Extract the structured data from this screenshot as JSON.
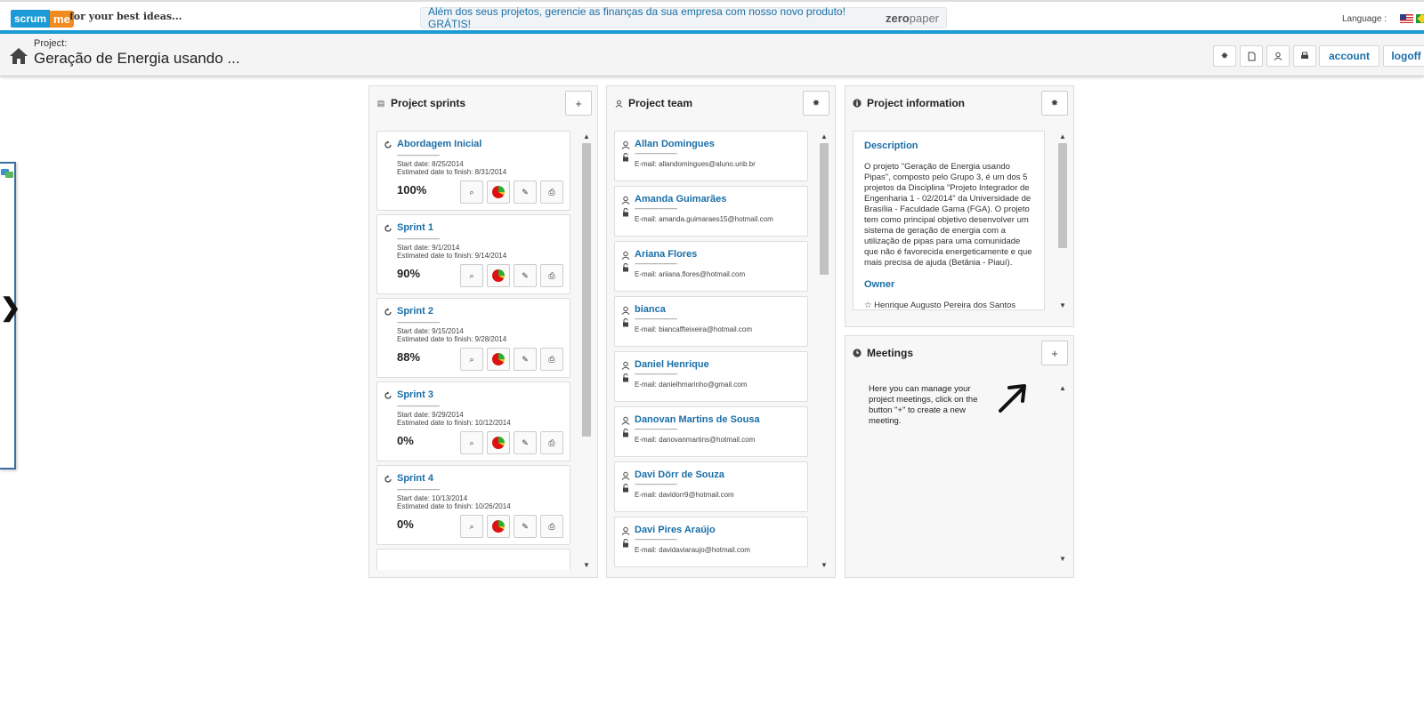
{
  "header": {
    "logo_left": "scrum",
    "logo_right": "me",
    "tagline": "for your best ideas...",
    "promo_text": "Além dos seus projetos, gerencie as finanças da sua empresa com nosso novo produto!  GRÁTIS!",
    "promo_logo_a": "zero",
    "promo_logo_b": "paper",
    "language_label": "Language :"
  },
  "project": {
    "label": "Project:",
    "title": "Geração de Energia usando ...",
    "account_label": "account",
    "logoff_label": "logoff"
  },
  "sprints_panel": {
    "title": "Project sprints",
    "add_label": "+",
    "items": [
      {
        "name": "Abordagem Inicial",
        "dash": "----------------------",
        "start": "Start date: 8/25/2014",
        "finish": "Estimated date to finish: 8/31/2014",
        "percent": "100%"
      },
      {
        "name": "Sprint 1",
        "dash": "----------------------",
        "start": "Start date: 9/1/2014",
        "finish": "Estimated date to finish: 9/14/2014",
        "percent": "90%"
      },
      {
        "name": "Sprint 2",
        "dash": "----------------------",
        "start": "Start date: 9/15/2014",
        "finish": "Estimated date to finish: 9/28/2014",
        "percent": "88%"
      },
      {
        "name": "Sprint 3",
        "dash": "----------------------",
        "start": "Start date: 9/29/2014",
        "finish": "Estimated date to finish: 10/12/2014",
        "percent": "0%"
      },
      {
        "name": "Sprint 4",
        "dash": "----------------------",
        "start": "Start date: 10/13/2014",
        "finish": "Estimated date to finish: 10/26/2014",
        "percent": "0%"
      }
    ]
  },
  "team_panel": {
    "title": "Project team",
    "members": [
      {
        "name": "Allan Domingues",
        "dash": "----------------------",
        "email": "E-mail: allandomingues@aluno.unb.br"
      },
      {
        "name": "Amanda Guimarães",
        "dash": "----------------------",
        "email": "E-mail: amanda.guimaraes15@hotmail.com"
      },
      {
        "name": "Ariana Flores",
        "dash": "----------------------",
        "email": "E-mail: ariiana.flores@hotmail.com"
      },
      {
        "name": "bianca",
        "dash": "----------------------",
        "email": "E-mail: biancaffteixeira@hotmail.com"
      },
      {
        "name": "Daniel Henrique",
        "dash": "----------------------",
        "email": "E-mail: danielhmarinho@gmail.com"
      },
      {
        "name": "Danovan Martins de Sousa",
        "dash": "----------------------",
        "email": "E-mail: danovanmartins@hotmail.com"
      },
      {
        "name": "Davi Dörr de Souza",
        "dash": "----------------------",
        "email": "E-mail: davidorr9@hotmail.com"
      },
      {
        "name": "Davi Pires Araújo",
        "dash": "----------------------",
        "email": "E-mail: davidaviaraujo@hotmail.com"
      }
    ]
  },
  "info_panel": {
    "title": "Project information",
    "description_heading": "Description",
    "description": "O projeto \"Geração de Energia usando Pipas\", composto pelo Grupo 3, é um dos 5 projetos da Disciplina \"Projeto Integrador de Engenharia 1 - 02/2014\" da Universidade de Brasília - Faculdade Gama (FGA). O projeto tem como principal objetivo desenvolver um sistema de geração de energia com a utilização de pipas para uma comunidade que não é favorecida energeticamente e que mais precisa de ajuda (Betânia - Piauí).",
    "owner_heading": "Owner",
    "owner_name": "Henrique Augusto Pereira dos Santos"
  },
  "meetings_panel": {
    "title": "Meetings",
    "add_label": "+",
    "help_text": "Here you can manage your project meetings, click on the button \"+\" to create a new meeting."
  }
}
